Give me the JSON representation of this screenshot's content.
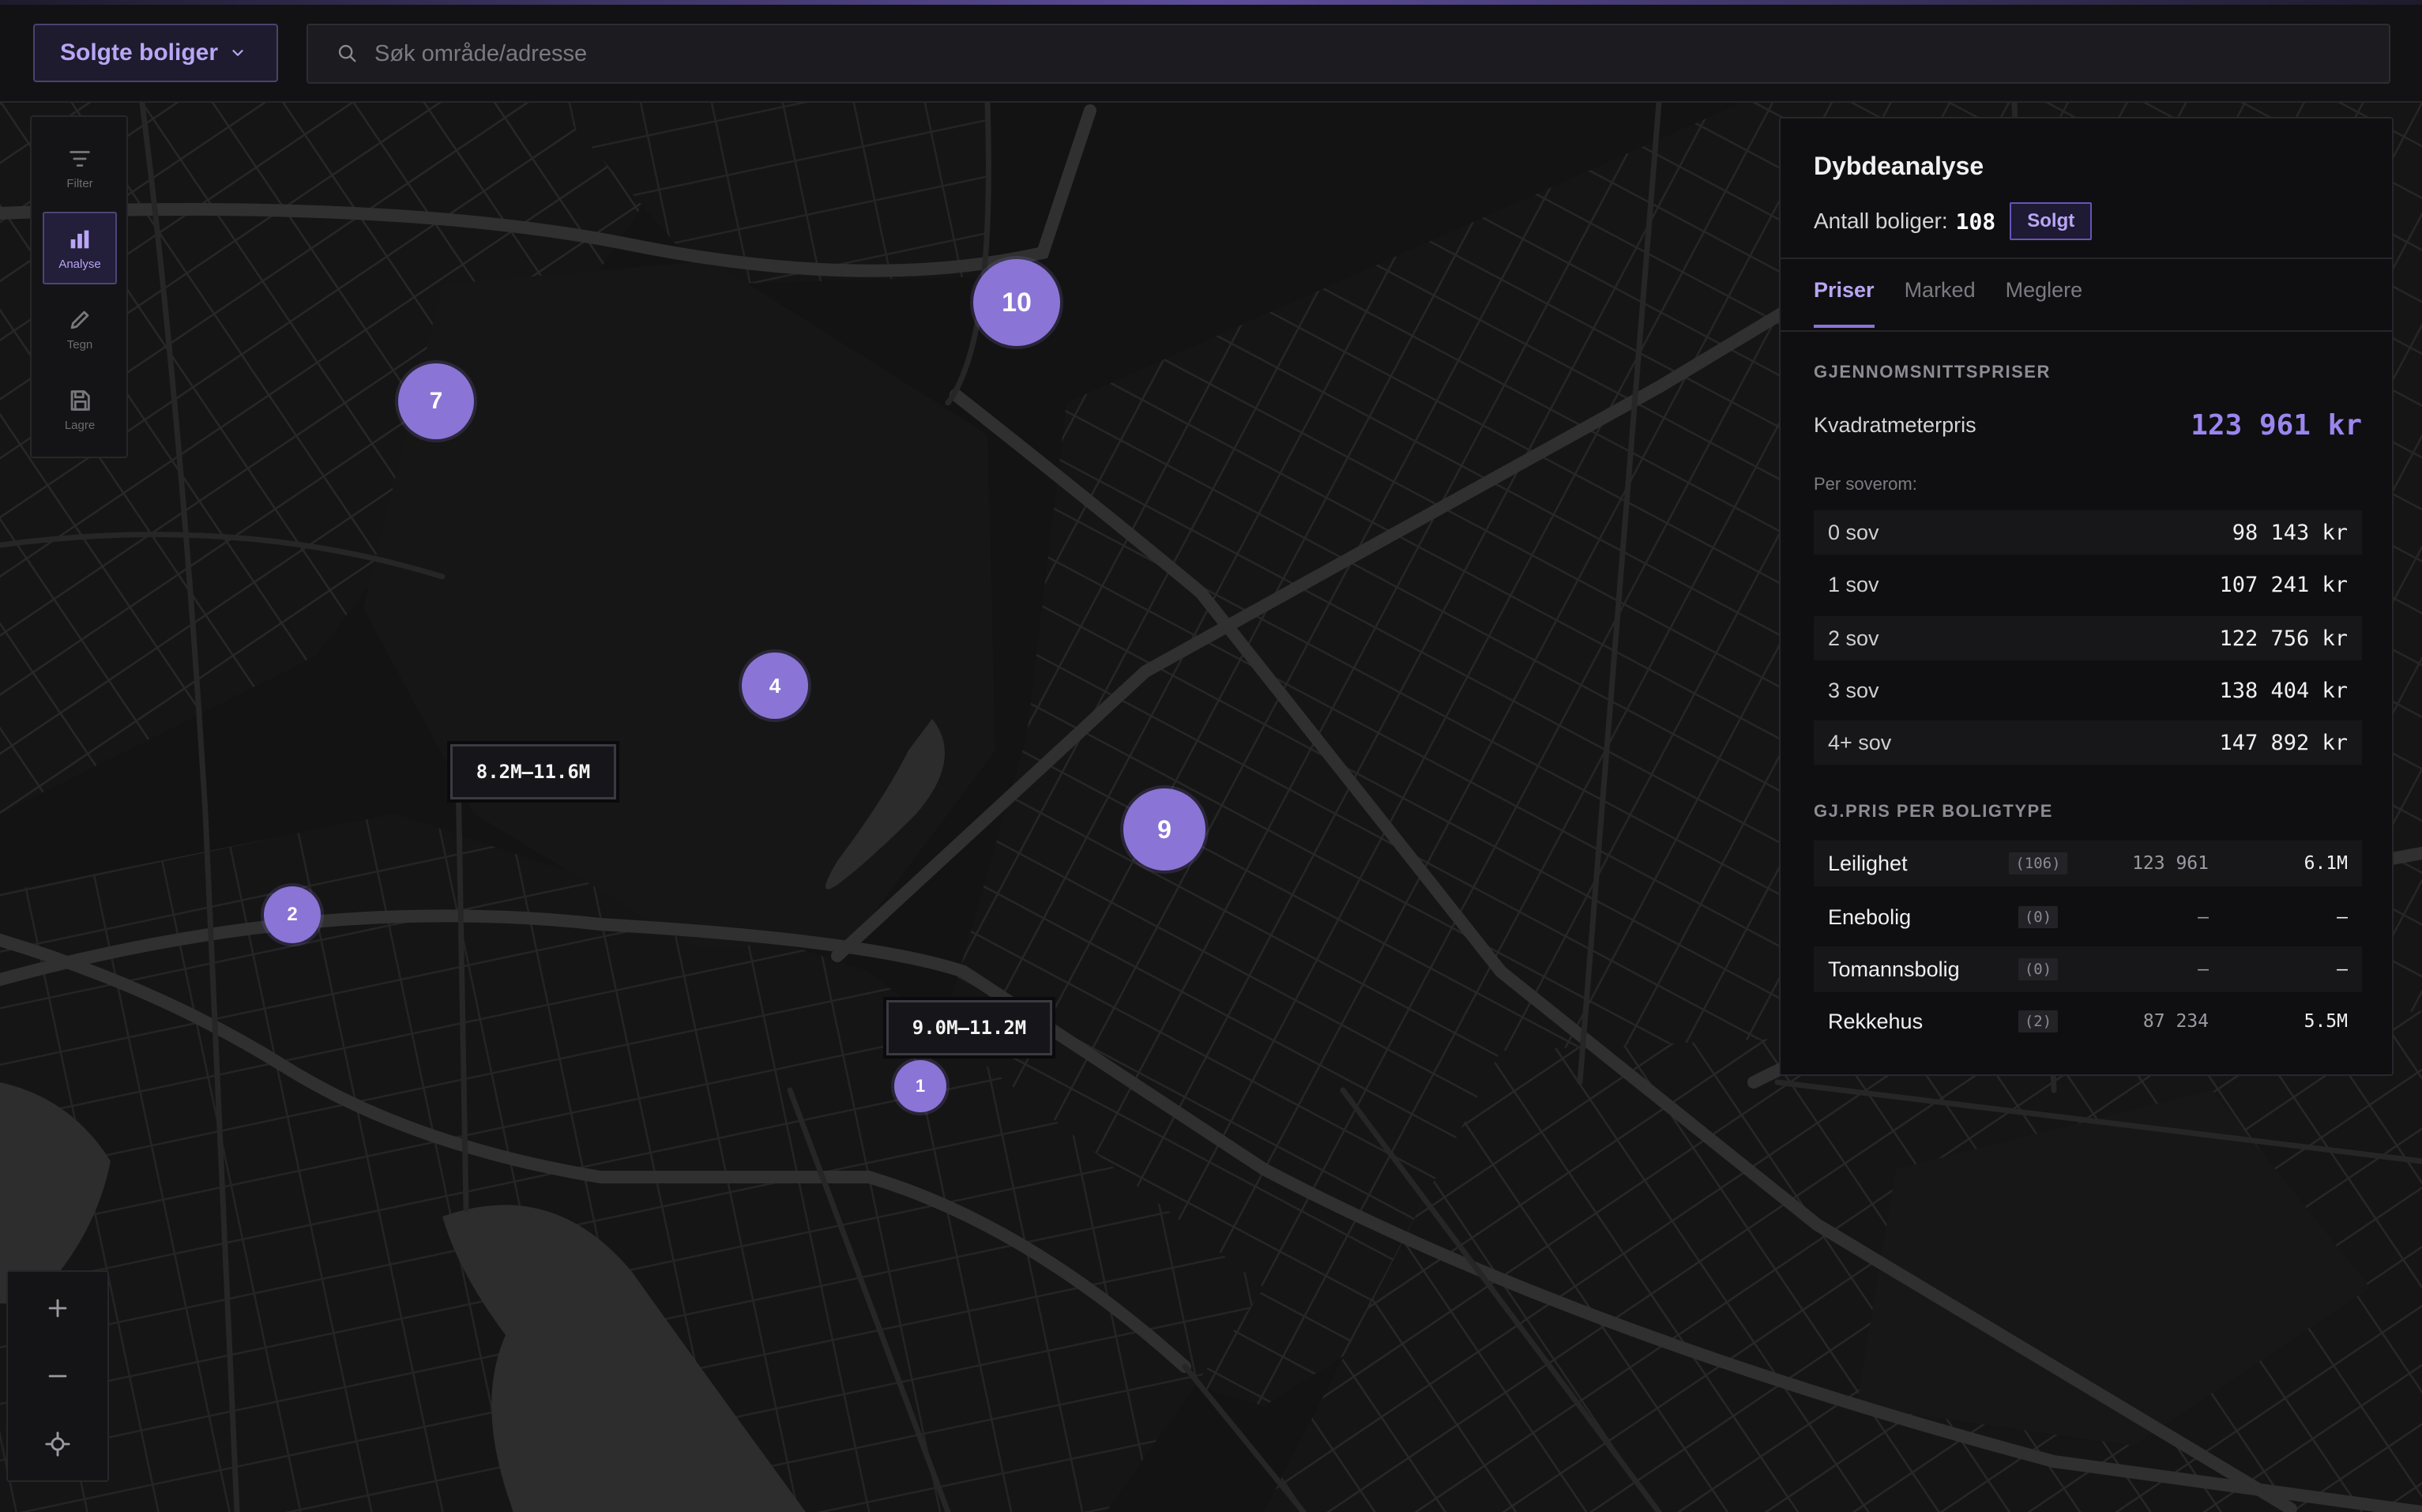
{
  "header": {
    "mode_label": "Solgte boliger",
    "search_placeholder": "Søk område/adresse"
  },
  "tools": [
    {
      "label": "Filter",
      "icon": "filter-icon"
    },
    {
      "label": "Analyse",
      "icon": "bar-chart-icon",
      "active": true
    },
    {
      "label": "Tegn",
      "icon": "pencil-icon"
    },
    {
      "label": "Lagre",
      "icon": "save-icon"
    }
  ],
  "map": {
    "clusters": [
      "10",
      "7",
      "4",
      "9",
      "2",
      "1"
    ],
    "price_labels": [
      "8.2M–11.6M",
      "9.0M–11.2M"
    ]
  },
  "panel": {
    "title": "Dybdeanalyse",
    "count_label": "Antall boliger:",
    "count_value": "108",
    "status_badge": "Solgt",
    "tabs": [
      "Priser",
      "Marked",
      "Meglere"
    ],
    "active_tab": "Priser",
    "avg_heading": "GJENNOMSNITTSPRISER",
    "sqm_label": "Kvadratmeterpris",
    "sqm_value": "123 961 kr",
    "bedroom_heading": "Per soverom:",
    "bedrooms": [
      {
        "label": "0 sov",
        "value": "98 143 kr"
      },
      {
        "label": "1 sov",
        "value": "107 241 kr"
      },
      {
        "label": "2 sov",
        "value": "122 756 kr"
      },
      {
        "label": "3 sov",
        "value": "138 404 kr"
      },
      {
        "label": "4+ sov",
        "value": "147 892 kr"
      }
    ],
    "type_heading": "GJ.PRIS PER BOLIGTYPE",
    "types": [
      {
        "name": "Leilighet",
        "count": "(106)",
        "avg": "123 961",
        "total": "6.1M"
      },
      {
        "name": "Enebolig",
        "count": "(0)",
        "avg": "–",
        "total": "–"
      },
      {
        "name": "Tomannsbolig",
        "count": "(0)",
        "avg": "–",
        "total": "–"
      },
      {
        "name": "Rekkehus",
        "count": "(2)",
        "avg": "87 234",
        "total": "5.5M"
      }
    ]
  },
  "colors": {
    "accent": "#8a74d6",
    "accent_text": "#b9a6f4",
    "background": "#131313"
  }
}
